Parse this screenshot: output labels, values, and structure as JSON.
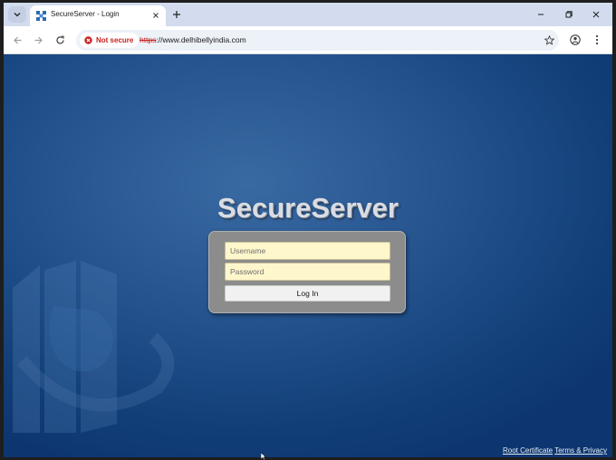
{
  "browser": {
    "tab_title": "SecureServer - Login",
    "security_label": "Not secure",
    "url_scheme": "https",
    "url_rest": "://www.delhibellyindia.com",
    "icons": {
      "tab_search": "chevron-down-icon",
      "favicon": "globe-grid-icon",
      "tab_close": "close-icon",
      "new_tab": "plus-icon",
      "minimize": "minimize-icon",
      "restore": "restore-icon",
      "close_window": "close-icon",
      "back": "arrow-left-icon",
      "forward": "arrow-right-icon",
      "reload": "reload-icon",
      "warning": "warning-icon",
      "bookmark": "star-icon",
      "profile": "profile-icon",
      "menu": "kebab-menu-icon"
    }
  },
  "page": {
    "brand": "SecureServer",
    "username_placeholder": "Username",
    "password_placeholder": "Password",
    "login_label": "Log In",
    "footer": {
      "root_certificate": "Root Certificate",
      "terms_privacy": "Terms & Privacy"
    }
  },
  "colors": {
    "background_blue": "#24538e",
    "panel_gray": "#8c8c8c",
    "field_yellow": "#fff7cc",
    "warning_red": "#c5221f"
  }
}
